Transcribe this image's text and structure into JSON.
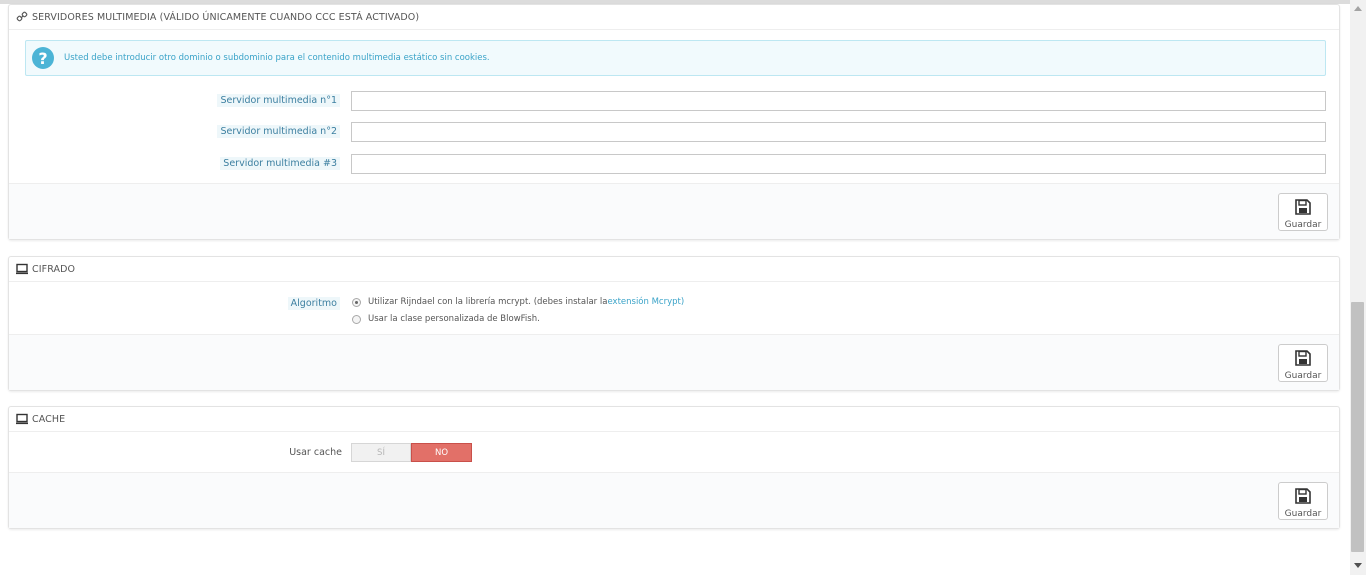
{
  "media_panel": {
    "title": "SERVIDORES MULTIMEDIA (VÁLIDO ÚNICAMENTE CUANDO CCC ESTÁ ACTIVADO)",
    "info": "Usted debe introducir otro dominio o subdominio para el contenido multimedia estático sin cookies.",
    "fields": [
      {
        "label": "Servidor multimedia n°1",
        "value": ""
      },
      {
        "label": "Servidor multimedia n°2",
        "value": ""
      },
      {
        "label": "Servidor multimedia #3",
        "value": ""
      }
    ],
    "save_label": "Guardar"
  },
  "cipher_panel": {
    "title": "CIFRADO",
    "label": "Algoritmo",
    "option1_text": "Utilizar Rijndael con la librería mcrypt. (debes instalar la ",
    "option1_link": "extensión Mcrypt",
    "option1_end": ")",
    "option2_text": "Usar la clase personalizada de BlowFish.",
    "selected": 0,
    "save_label": "Guardar"
  },
  "cache_panel": {
    "title": "CACHE",
    "label": "Usar cache",
    "yes_label": "SÍ",
    "no_label": "NO",
    "value": "NO",
    "save_label": "Guardar"
  },
  "icons": {
    "media": "link-icon",
    "cipher": "monitor-icon",
    "cache": "monitor-icon",
    "save": "floppy-disk-icon",
    "info": "question-circle-icon"
  },
  "colors": {
    "accent": "#3aa3c8",
    "no_active": "#e27068",
    "info_bg": "#f1fafd"
  }
}
